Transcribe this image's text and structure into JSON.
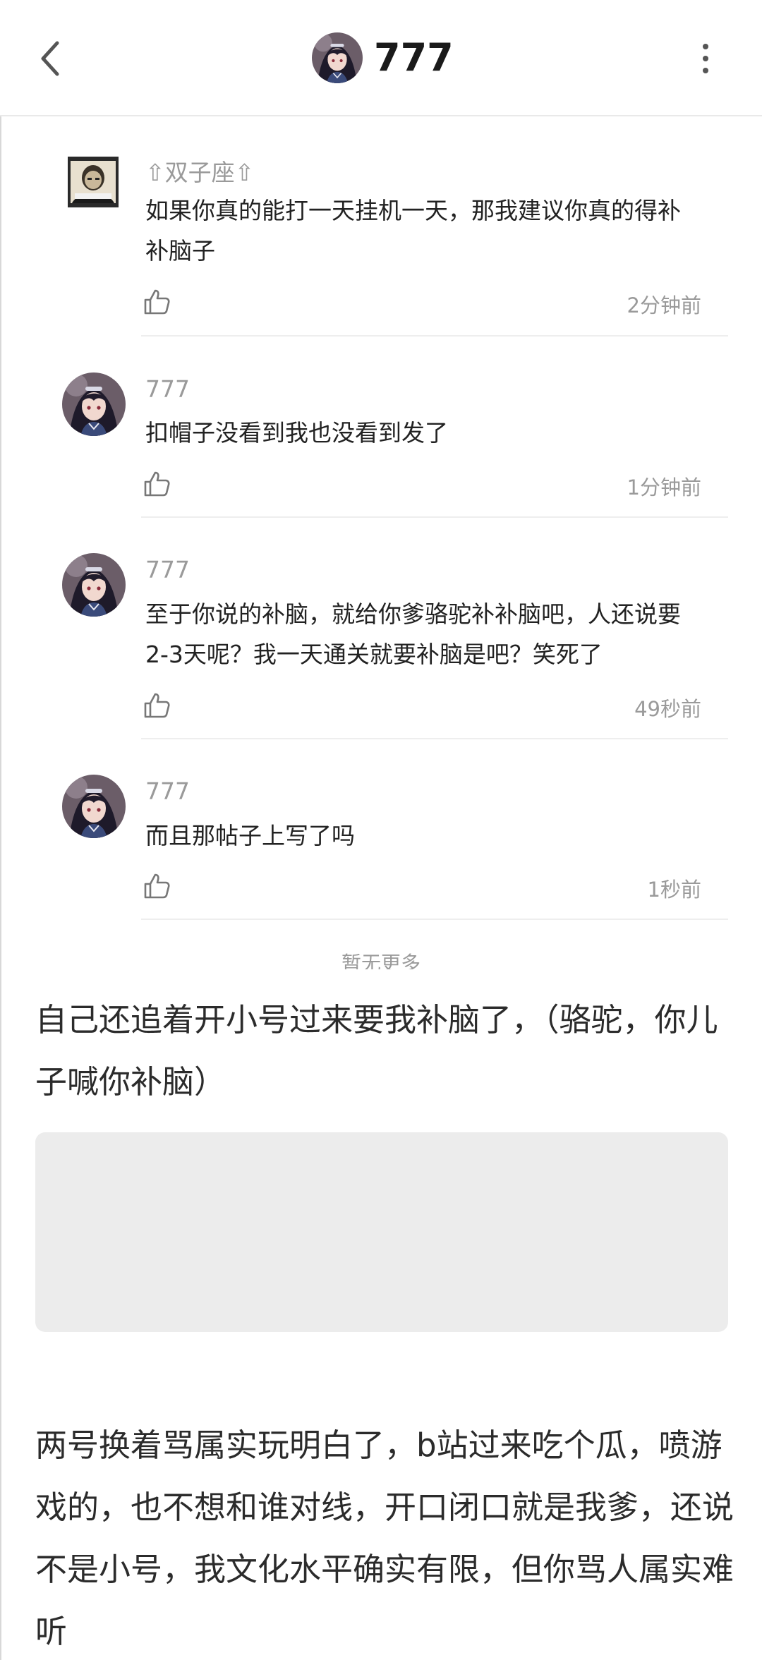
{
  "header": {
    "title": "777",
    "back_icon": "chevron-left-icon",
    "more_icon": "more-vertical-icon"
  },
  "comments": [
    {
      "author": "⇧双子座⇧",
      "avatar": "meme-avatar",
      "text": "如果你真的能打一天挂机一天，那我建议你真的得补补脑子",
      "time": "2分钟前",
      "like_icon": "thumbs-up-icon"
    },
    {
      "author": "777",
      "avatar": "anime-girl-avatar",
      "text": "扣帽子没看到我也没看到发了",
      "time": "1分钟前",
      "like_icon": "thumbs-up-icon"
    },
    {
      "author": "777",
      "avatar": "anime-girl-avatar",
      "text": "至于你说的补脑，就给你爹骆驼补补脑吧，人还说要2-3天呢？我一天通关就要补脑是吧？笑死了",
      "time": "49秒前",
      "like_icon": "thumbs-up-icon"
    },
    {
      "author": "777",
      "avatar": "anime-girl-avatar",
      "text": "而且那帖子上写了吗",
      "time": "1秒前",
      "like_icon": "thumbs-up-icon"
    }
  ],
  "no_more_text": "暂无更多",
  "post": {
    "paragraph_1": "自己还追着开小号过来要我补脑了，（骆驼，你儿子喊你补脑）",
    "paragraph_2": "两号换着骂属实玩明白了，b站过来吃个瓜，喷游戏的，也不想和谁对线，开口闭口就是我爹，还说不是小号，我文化水平确实有限，但你骂人属实难听"
  },
  "colors": {
    "text": "#222222",
    "muted": "#9a9a9a",
    "divider": "#eeeeee",
    "placeholder": "#ececec"
  }
}
